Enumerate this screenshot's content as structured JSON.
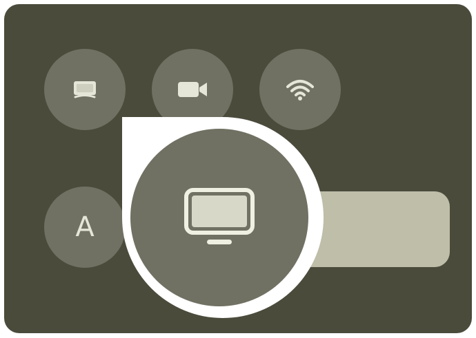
{
  "quick_settings": {
    "tiles": [
      {
        "id": "cast",
        "icon": "screen-cast-icon"
      },
      {
        "id": "camera",
        "icon": "video-camera-icon"
      },
      {
        "id": "wifi",
        "icon": "wifi-icon"
      }
    ],
    "font_tile": {
      "icon": "font-size-icon",
      "letter": "A"
    },
    "focused_tile": {
      "icon": "display-monitor-icon"
    }
  },
  "colors": {
    "panel_background": "#4b4b3c",
    "tile_background": "#717163",
    "icon_color": "#e6e6d8",
    "track_color": "#bebea9",
    "highlight_color": "#ffffff"
  }
}
